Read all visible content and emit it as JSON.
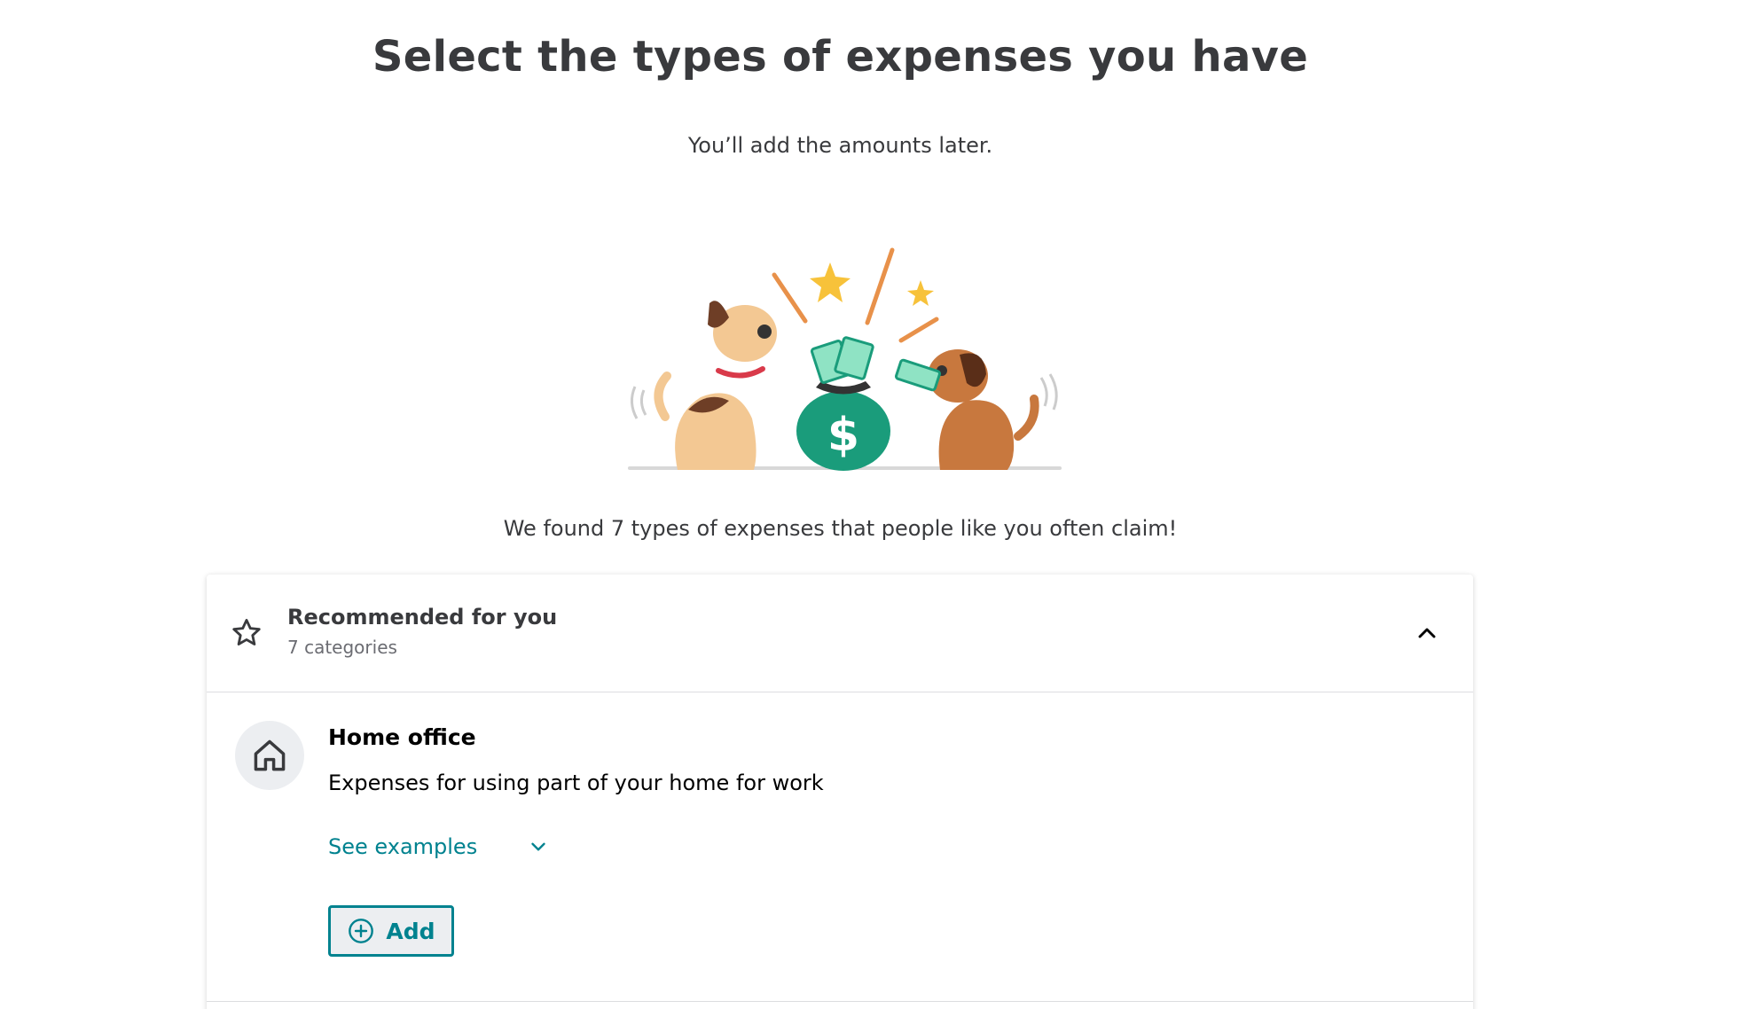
{
  "header": {
    "title": "Select the types of expenses you have",
    "subtitle": "You’ll add the amounts later."
  },
  "illustration": {
    "icon": "dogs-money-bag-illustration"
  },
  "found_text": "We found 7 types of expenses that people like you often claim!",
  "recommended": {
    "title": "Recommended for you",
    "count_label": "7 categories",
    "icon": "star-icon",
    "toggle_icon": "chevron-up-icon"
  },
  "items": [
    {
      "title": "Home office",
      "description": "Expenses for using part of your home for work",
      "icon": "house-icon",
      "see_examples_label": "See examples",
      "add_label": "Add"
    }
  ],
  "colors": {
    "accent": "#00828f",
    "text": "#393a3d",
    "muted": "#6b6c72",
    "icon_bg": "#eceef1"
  }
}
